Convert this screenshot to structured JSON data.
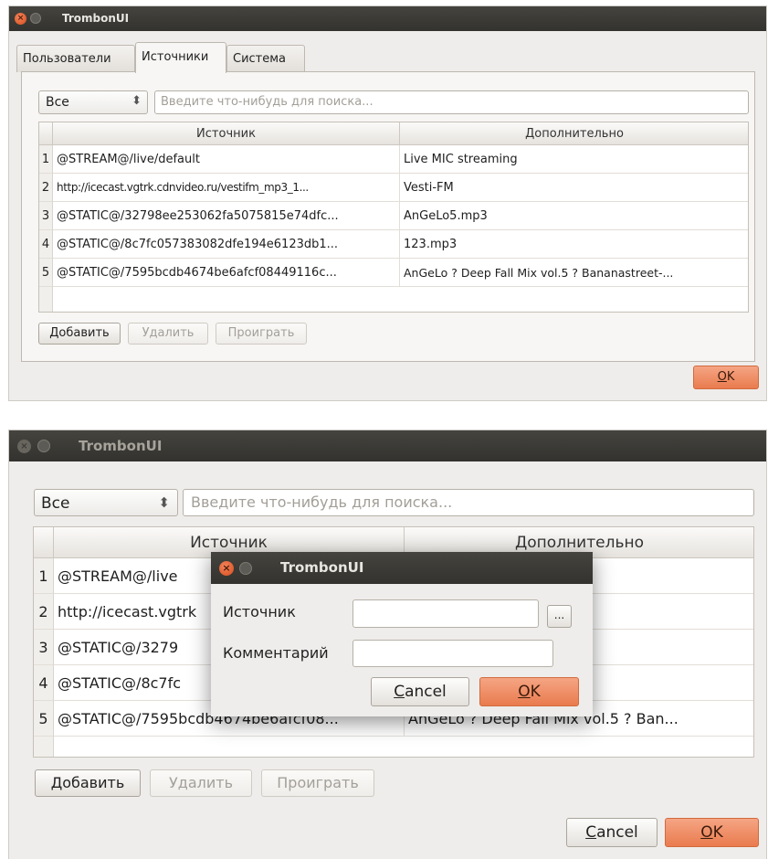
{
  "window1": {
    "title": "TrombonUI",
    "tabs": [
      {
        "label": "Пользователи",
        "active": false
      },
      {
        "label": "Источники",
        "active": true
      },
      {
        "label": "Система",
        "active": false
      }
    ],
    "filter": {
      "selected": "Все",
      "arrow": "⬍"
    },
    "search": {
      "placeholder": "Введите что-нибудь для поиска..."
    },
    "table": {
      "columns": [
        "Источник",
        "Дополнительно"
      ],
      "rows": [
        {
          "num": "1",
          "source": "@STREAM@/live/default",
          "extra": "Live MIC streaming"
        },
        {
          "num": "2",
          "source": "http://icecast.vgtrk.cdnvideo.ru/vestifm_mp3_1...",
          "extra": "Vesti-FM"
        },
        {
          "num": "3",
          "source": "@STATIC@/32798ee253062fa5075815e74dfc...",
          "extra": "AnGeLo5.mp3"
        },
        {
          "num": "4",
          "source": "@STATIC@/8c7fc057383082dfe194e6123db1...",
          "extra": "123.mp3"
        },
        {
          "num": "5",
          "source": "@STATIC@/7595bcdb4674be6afcf08449116c...",
          "extra": "AnGeLo ? Deep Fall Mix vol.5 ? Bananastreet-..."
        }
      ]
    },
    "buttons": {
      "add": "Добавить",
      "delete": "Удалить",
      "play": "Проиграть"
    },
    "ok": {
      "underlined": "O",
      "rest": "K"
    }
  },
  "window2": {
    "title": "TrombonUI",
    "filter": {
      "selected": "Все",
      "arrow": "⬍"
    },
    "search": {
      "placeholder": "Введите что-нибудь для поиска..."
    },
    "table": {
      "columns": [
        "Источник",
        "Дополнительно"
      ],
      "rows": [
        {
          "num": "1",
          "source": "@STREAM@/live",
          "extra": ""
        },
        {
          "num": "2",
          "source": "http://icecast.vgtrk",
          "extra": ""
        },
        {
          "num": "3",
          "source": "@STATIC@/3279",
          "extra": ""
        },
        {
          "num": "4",
          "source": "@STATIC@/8c7fc",
          "extra": ""
        },
        {
          "num": "5",
          "source": "@STATIC@/7595bcdb4674be6afcf08...",
          "extra": "AnGeLo ? Deep Fall Mix vol.5 ? Ban..."
        }
      ]
    },
    "buttons": {
      "add": "Добавить",
      "delete": "Удалить",
      "play": "Проиграть"
    },
    "cancel": {
      "underlined": "C",
      "rest": "ancel"
    },
    "ok": {
      "underlined": "O",
      "rest": "K"
    }
  },
  "dialog": {
    "title": "TrombonUI",
    "source_label": "Источник",
    "comment_label": "Комментарий",
    "browse_label": "...",
    "source_value": "",
    "comment_value": "",
    "cancel": {
      "underlined": "C",
      "rest": "ancel"
    },
    "ok": {
      "underlined": "O",
      "rest": "K"
    }
  }
}
